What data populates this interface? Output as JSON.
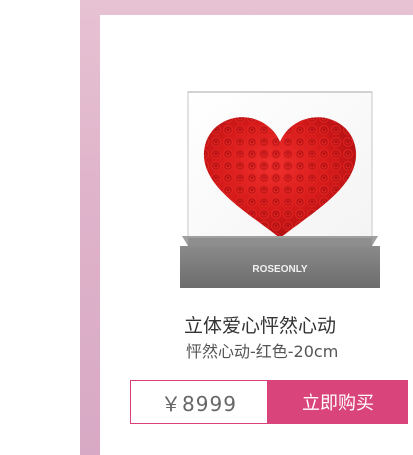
{
  "product": {
    "brand_label": "ROSEONLY",
    "title": "立体爱心怦然心动",
    "subtitle": "怦然心动-红色-20cm",
    "price": "￥8999",
    "buy_button_label": "立即购买"
  },
  "colors": {
    "accent": "#d9457a",
    "frame": "#dfb3ca",
    "rose": "#dc1b1b",
    "box_base": "#7f7f7f"
  }
}
